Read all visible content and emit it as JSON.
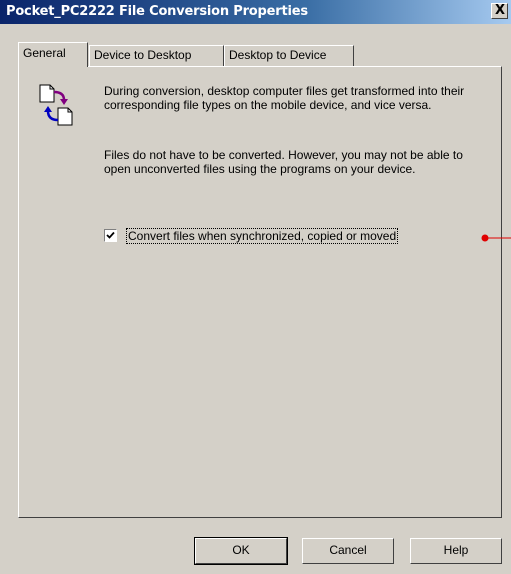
{
  "window": {
    "title": "Pocket_PC2222 File Conversion Properties",
    "close_glyph": "X"
  },
  "tabs": [
    {
      "label": "General",
      "active": true
    },
    {
      "label": "Device to Desktop",
      "active": false
    },
    {
      "label": "Desktop to Device",
      "active": false
    }
  ],
  "general": {
    "icon": "file-conversion-icon",
    "paragraph1": "During conversion, desktop computer files get transformed into their corresponding file types on the mobile device, and vice versa.",
    "paragraph2": "Files do not have to be converted. However, you may not be able to open unconverted files using the programs on your device.",
    "convert_checkbox": {
      "label": "Convert files when synchronized, copied or moved",
      "checked": true
    }
  },
  "buttons": {
    "ok": "OK",
    "cancel": "Cancel",
    "help": "Help"
  },
  "colors": {
    "title_start": "#0a246a",
    "title_end": "#a6caf0",
    "face": "#d4d0c8",
    "marker": "#e00000"
  }
}
